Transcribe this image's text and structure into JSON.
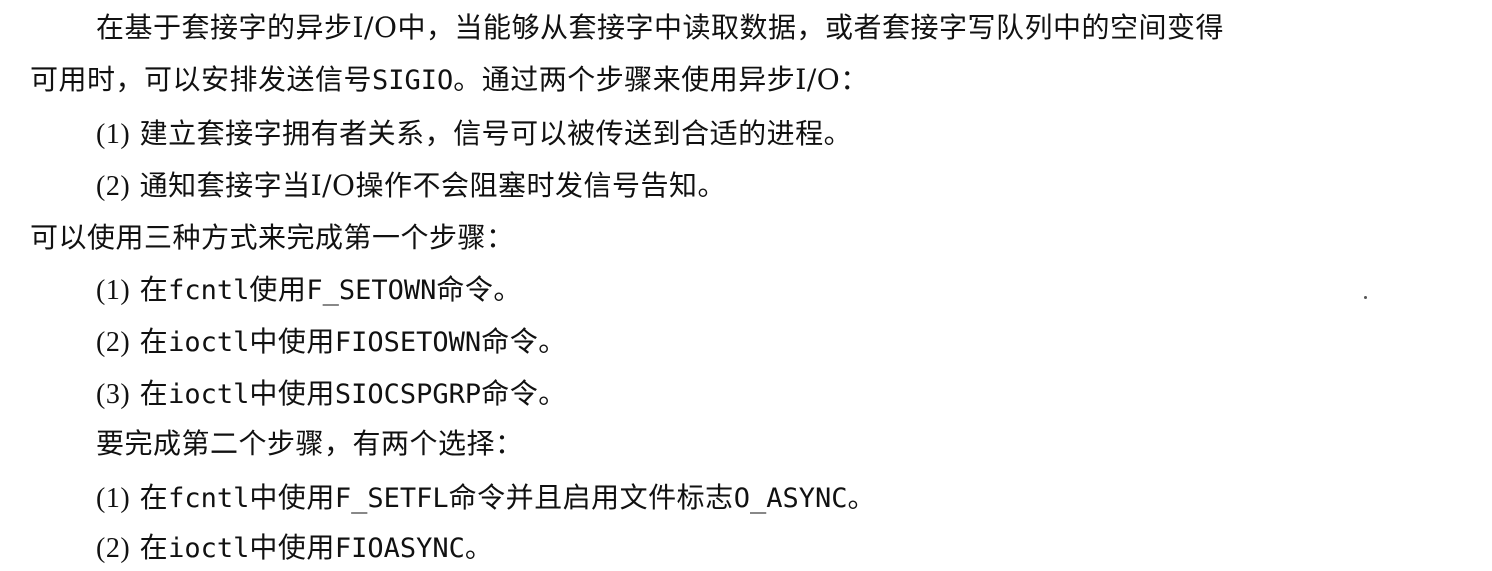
{
  "paragraph1": {
    "line1": "在基于套接字的异步I/O中，当能够从套接字中读取数据，或者套接字写队列中的空间变得",
    "line2_before": "可用时，可以安排发送信号",
    "line2_code": "SIGIO",
    "line2_after": "。通过两个步骤来使用异步I/O："
  },
  "steps": [
    {
      "num": "(1)",
      "text": "建立套接字拥有者关系，信号可以被传送到合适的进程。"
    },
    {
      "num": "(2)",
      "text": "通知套接字当I/O操作不会阻塞时发信号告知。"
    }
  ],
  "step1_intro": "可以使用三种方式来完成第一个步骤：",
  "step1_methods": [
    {
      "num": "(1)",
      "pre": "在",
      "code1": "fcntl",
      "mid": "使用",
      "code2": "F_SETOWN",
      "post": "命令。"
    },
    {
      "num": "(2)",
      "pre": "在",
      "code1": "ioctl",
      "mid": "中使用",
      "code2": "FIOSETOWN",
      "post": "命令。"
    },
    {
      "num": "(3)",
      "pre": "在",
      "code1": "ioctl",
      "mid": "中使用",
      "code2": "SIOCSPGRP",
      "post": "命令。"
    }
  ],
  "step2_intro": "要完成第二个步骤，有两个选择：",
  "step2_methods": [
    {
      "num": "(1)",
      "pre": "在",
      "code1": "fcntl",
      "mid": "中使用",
      "code2": "F_SETFL",
      "mid2": "命令并且启用文件标志",
      "code3": "O_ASYNC",
      "post": "。"
    },
    {
      "num": "(2)",
      "pre": "在",
      "code1": "ioctl",
      "mid": "中使用",
      "code2": "FIOASYNC",
      "post": "。"
    }
  ]
}
